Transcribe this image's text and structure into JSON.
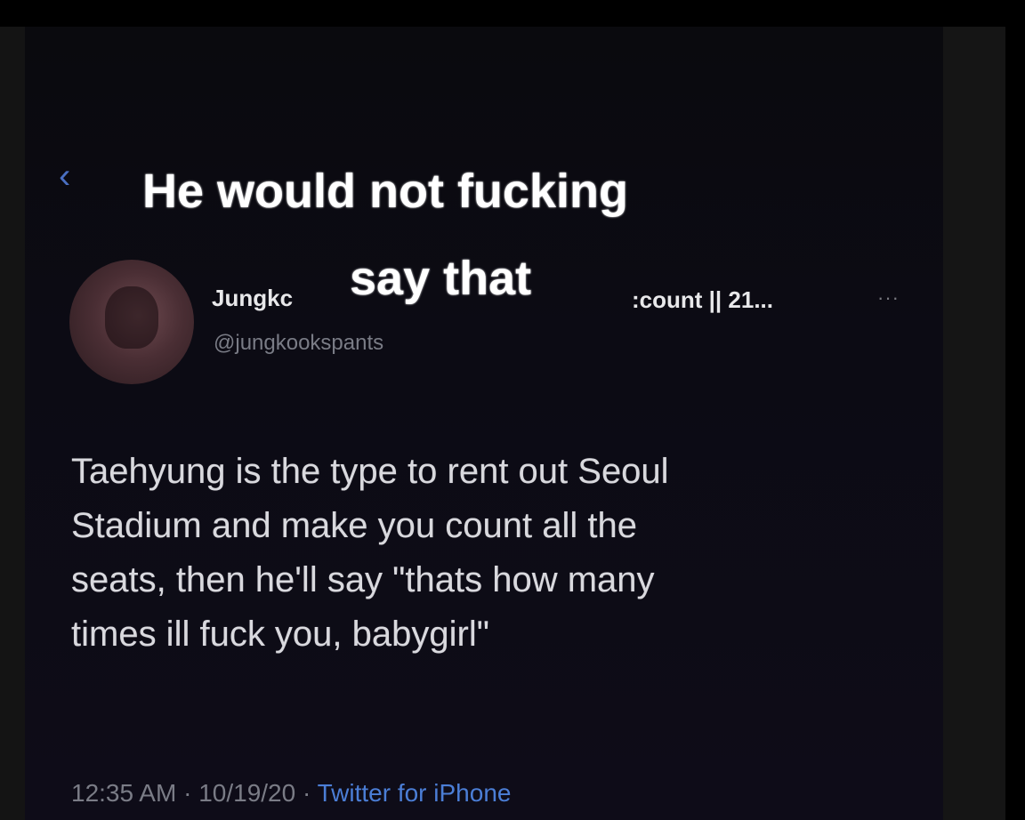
{
  "caption": {
    "line1": "He would not fucking",
    "line2": "say that"
  },
  "nav": {
    "back_icon": "chevron-left-icon",
    "back_glyph": "‹"
  },
  "tweet": {
    "display_name_prefix": "Jungkc",
    "display_name_suffix": ":count || 21...",
    "handle": "@jungkookspants",
    "more_glyph": "···",
    "text_lines": [
      "Taehyung is the type to rent out Seoul",
      "Stadium and make you count all the",
      "seats, then he'll say \"thats how many",
      "times ill fuck you, babygirl\""
    ],
    "time": "12:35 AM",
    "date": "10/19/20",
    "separator": " · ",
    "source": "Twitter for iPhone"
  },
  "colors": {
    "background": "#000000",
    "link_blue": "#4b7ed6",
    "muted_gray": "#7a7c86"
  }
}
